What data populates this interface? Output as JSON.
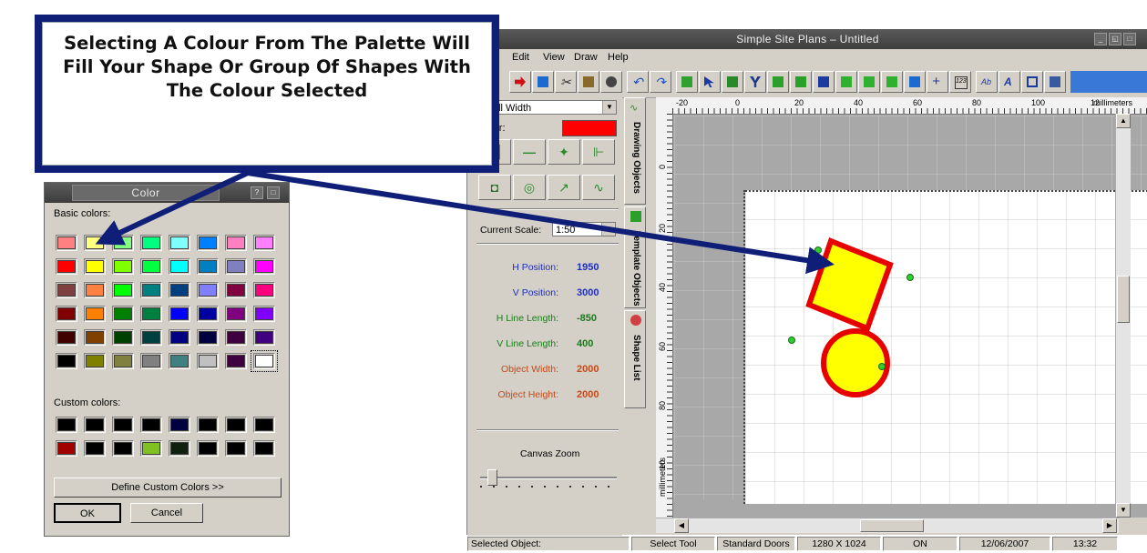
{
  "window": {
    "title": "Simple Site Plans – Untitled",
    "menu": [
      "Edit",
      "View",
      "Draw",
      "Help"
    ]
  },
  "panel": {
    "wall_width_select": "Wall Width",
    "colour_label": "olour:",
    "colour_value": "#ff0000",
    "scale_label": "Current Scale:",
    "scale_value": "1:50",
    "zoom_label": "Canvas Zoom",
    "properties": [
      {
        "label": "H Position:",
        "value": "1950",
        "color": "#1f2fbf"
      },
      {
        "label": "V Position:",
        "value": "3000",
        "color": "#1f2fbf"
      },
      {
        "label": "H Line Length:",
        "value": "-850",
        "color": "#1a7a1a"
      },
      {
        "label": "V Line Length:",
        "value": "400",
        "color": "#1a7a1a"
      },
      {
        "label": "Object Width:",
        "value": "2000",
        "color": "#c44a1a"
      },
      {
        "label": "Object Height:",
        "value": "2000",
        "color": "#c44a1a"
      }
    ]
  },
  "tabs": [
    "Drawing Objects",
    "Template Objects",
    "Shape List"
  ],
  "ruler": {
    "h_ticks": [
      "-20",
      "0",
      "20",
      "40",
      "60",
      "80",
      "100",
      "12"
    ],
    "h_unit": "millimeters",
    "v_ticks": [
      "0",
      "20",
      "40",
      "60",
      "80",
      "10"
    ],
    "v_unit": "millimeters"
  },
  "statusbar": [
    "Selected Object:",
    "Select Tool",
    "Standard Doors",
    "1280 X 1024",
    "ON",
    "12/06/2007",
    "13:32"
  ],
  "color_dialog": {
    "title": "Color",
    "basic_label": "Basic colors:",
    "custom_label": "Custom colors:",
    "define_button": "Define Custom Colors >>",
    "ok_button": "OK",
    "cancel_button": "Cancel",
    "basic_colors": [
      [
        "#ff8080",
        "#ffff80",
        "#80ff80",
        "#00ff80",
        "#80ffff",
        "#0080ff",
        "#ff80c0",
        "#ff80ff"
      ],
      [
        "#ff0000",
        "#ffff00",
        "#80ff00",
        "#00ff40",
        "#00ffff",
        "#0080c0",
        "#8080c0",
        "#ff00ff"
      ],
      [
        "#804040",
        "#ff8040",
        "#00ff00",
        "#008080",
        "#004080",
        "#8080ff",
        "#800040",
        "#ff0080"
      ],
      [
        "#800000",
        "#ff8000",
        "#008000",
        "#008040",
        "#0000ff",
        "#0000a0",
        "#800080",
        "#8000ff"
      ],
      [
        "#400000",
        "#804000",
        "#004000",
        "#004040",
        "#000080",
        "#000040",
        "#400040",
        "#400080"
      ],
      [
        "#000000",
        "#808000",
        "#808040",
        "#808080",
        "#408080",
        "#c0c0c0",
        "#400040",
        "#ffffff"
      ]
    ],
    "custom_colors": [
      [
        "#000000",
        "#000000",
        "#000000",
        "#000000",
        "#000040",
        "#000000",
        "#000000",
        "#000000"
      ],
      [
        "#a00000",
        "#000000",
        "#000000",
        "#80c020",
        "#102010",
        "#000000",
        "#000000",
        "#000000"
      ]
    ]
  },
  "callout": {
    "text": "Selecting A Colour From The Palette Will Fill Your Shape Or Group Of Shapes With The Colour Selected"
  }
}
